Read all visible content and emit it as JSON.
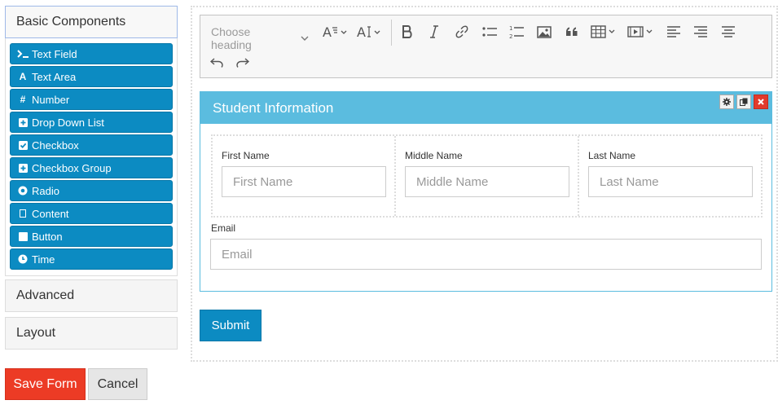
{
  "sidebar": {
    "basic_title": "Basic Components",
    "components": [
      {
        "label": "Text Field",
        "icon": "terminal-icon"
      },
      {
        "label": "Text Area",
        "icon": "font-icon"
      },
      {
        "label": "Number",
        "icon": "hash-icon"
      },
      {
        "label": "Drop Down List",
        "icon": "plus-square-icon"
      },
      {
        "label": "Checkbox",
        "icon": "check-square-icon"
      },
      {
        "label": "Checkbox Group",
        "icon": "plus-square-icon"
      },
      {
        "label": "Radio",
        "icon": "dot-circle-icon"
      },
      {
        "label": "Content",
        "icon": "square-outline-icon"
      },
      {
        "label": "Button",
        "icon": "stop-icon"
      },
      {
        "label": "Time",
        "icon": "clock-icon"
      }
    ],
    "advanced_title": "Advanced",
    "layout_title": "Layout"
  },
  "actions": {
    "save_label": "Save Form",
    "cancel_label": "Cancel"
  },
  "editor": {
    "heading_placeholder": "Choose heading"
  },
  "panel": {
    "title": "Student Information",
    "fields": [
      {
        "label": "First Name",
        "placeholder": "First Name"
      },
      {
        "label": "Middle Name",
        "placeholder": "Middle Name"
      },
      {
        "label": "Last Name",
        "placeholder": "Last Name"
      }
    ],
    "email": {
      "label": "Email",
      "placeholder": "Email"
    }
  },
  "submit_label": "Submit",
  "colors": {
    "primary": "#0c8bc2",
    "panel_header": "#5bbcdf",
    "save": "#ec3b25",
    "delete": "#e23a2c"
  }
}
